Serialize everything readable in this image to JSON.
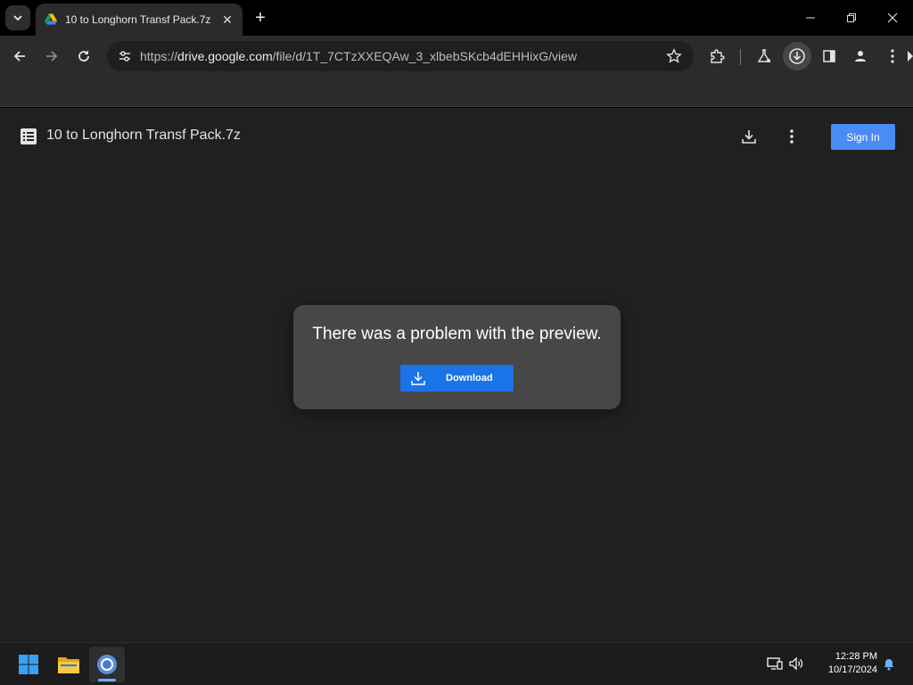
{
  "browser": {
    "tab": {
      "title": "10 to Longhorn Transf Pack.7z",
      "favicon": "google-drive-icon"
    },
    "url": {
      "prefix": "https://",
      "host": "drive.google.com",
      "path": "/file/d/1T_7CTzXXEQAw_3_xlbebSKcb4dEHHixG/view"
    }
  },
  "drive": {
    "file_name": "10 to Longhorn Transf Pack.7z",
    "sign_in_label": "Sign In",
    "dialog": {
      "message": "There was a problem with the preview.",
      "download_label": "Download"
    }
  },
  "taskbar": {
    "time": "12:28 PM",
    "date": "10/17/2024"
  },
  "colors": {
    "accent": "#1a73e8",
    "signin": "#4a8bf5",
    "page_bg": "#202020",
    "dialog_bg": "#474747"
  }
}
